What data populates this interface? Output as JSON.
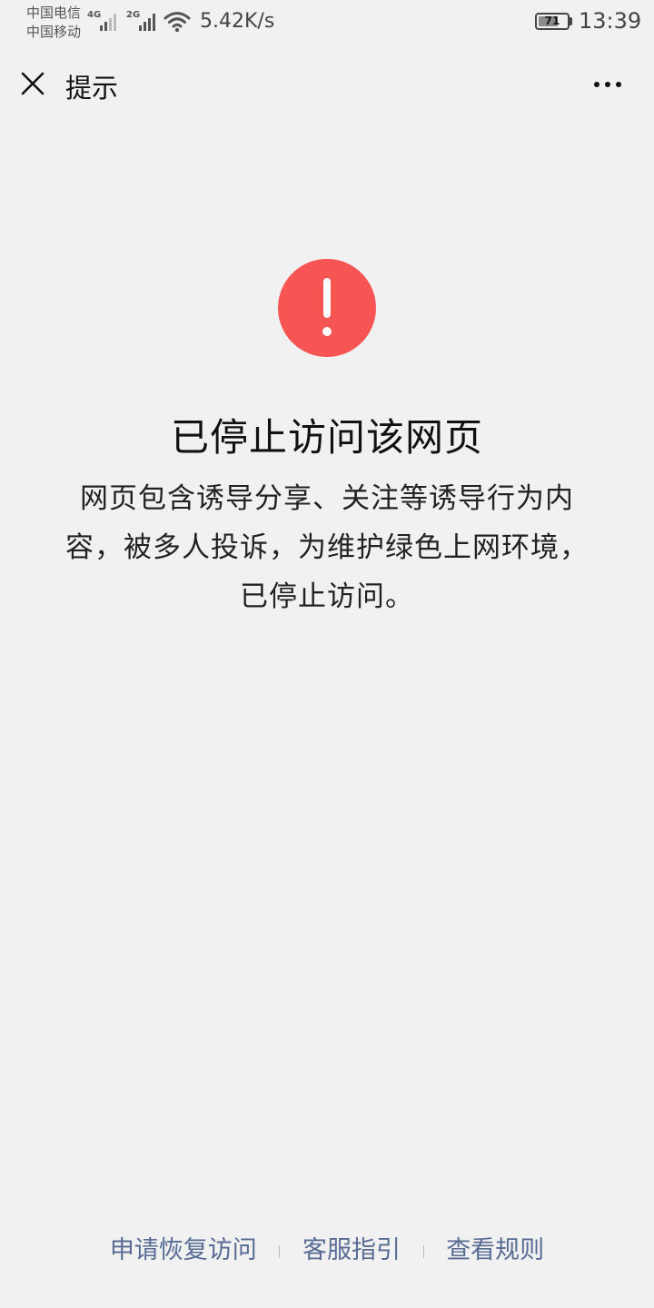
{
  "status_bar": {
    "carrier_1": "中国电信",
    "carrier_2": "中国移动",
    "signal_1_type": "4G",
    "signal_2_type": "2G",
    "net_speed": "5.42K/s",
    "battery_level": "71",
    "battery_percent": 71,
    "time": "13:39",
    "icons": [
      "signal-icon",
      "wifi-icon",
      "battery-icon"
    ]
  },
  "nav": {
    "title": "提示",
    "close_icon": "close-icon",
    "more_icon": "more-icon"
  },
  "main": {
    "icon": "warning-icon",
    "headline": "已停止访问该网页",
    "description": "网页包含诱导分享、关注等诱导行为内容，被多人投诉，为维护绿色上网环境，已停止访问。"
  },
  "footer": {
    "links": [
      {
        "label": "申请恢复访问"
      },
      {
        "label": "客服指引"
      },
      {
        "label": "查看规则"
      }
    ]
  },
  "colors": {
    "background": "#f1f1f1",
    "warning_red": "#f75553",
    "link_blue": "#576b95"
  }
}
